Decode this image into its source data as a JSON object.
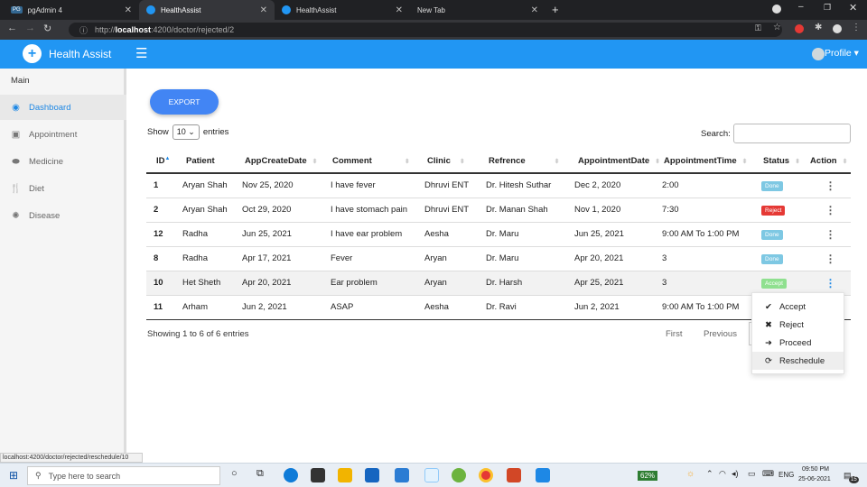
{
  "browser": {
    "tabs": [
      {
        "title": "pgAdmin 4",
        "active": false
      },
      {
        "title": "HealthAssist",
        "active": true
      },
      {
        "title": "HealthAssist",
        "active": false
      },
      {
        "title": "New Tab",
        "active": false
      }
    ],
    "url_prefix": "http://",
    "url_host": "localhost",
    "url_rest": ":4200/doctor/rejected/2",
    "status_url": "localhost:4200/doctor/rejected/reschedule/10"
  },
  "header": {
    "brand": "Health Assist",
    "profile": "Profile"
  },
  "sidebar": {
    "section": "Main",
    "items": [
      {
        "label": "Dashboard",
        "icon": "dashboard-icon",
        "active": true
      },
      {
        "label": "Appointment",
        "icon": "calendar-icon",
        "active": false
      },
      {
        "label": "Medicine",
        "icon": "pills-icon",
        "active": false
      },
      {
        "label": "Diet",
        "icon": "utensils-icon",
        "active": false
      },
      {
        "label": "Disease",
        "icon": "virus-icon",
        "active": false
      }
    ]
  },
  "main": {
    "export_label": "EXPORT",
    "show_label": "Show",
    "entries_value": "10",
    "entries_label": "entries",
    "search_label": "Search:",
    "search_value": "",
    "columns": [
      "ID",
      "Patient",
      "AppCreateDate",
      "Comment",
      "Clinic",
      "Refrence",
      "AppointmentDate",
      "AppointmentTime",
      "Status",
      "Action"
    ],
    "rows": [
      {
        "id": "1",
        "patient": "Aryan Shah",
        "created": "Nov 25, 2020",
        "comment": "I have fever",
        "clinic": "Dhruvi ENT",
        "ref": "Dr. Hitesh Suthar",
        "date": "Dec 2, 2020",
        "time": "2:00",
        "status": "Done"
      },
      {
        "id": "2",
        "patient": "Aryan Shah",
        "created": "Oct 29, 2020",
        "comment": "I have stomach pain",
        "clinic": "Dhruvi ENT",
        "ref": "Dr. Manan Shah",
        "date": "Nov 1, 2020",
        "time": "7:30",
        "status": "Reject"
      },
      {
        "id": "12",
        "patient": "Radha",
        "created": "Jun 25, 2021",
        "comment": "I have ear problem",
        "clinic": "Aesha",
        "ref": "Dr. Maru",
        "date": "Jun 25, 2021",
        "time": "9:00 AM To 1:00 PM",
        "status": "Done"
      },
      {
        "id": "8",
        "patient": "Radha",
        "created": "Apr 17, 2021",
        "comment": "Fever",
        "clinic": "Aryan",
        "ref": "Dr. Maru",
        "date": "Apr 20, 2021",
        "time": "3",
        "status": "Done"
      },
      {
        "id": "10",
        "patient": "Het Sheth",
        "created": "Apr 20, 2021",
        "comment": "Ear problem",
        "clinic": "Aryan",
        "ref": "Dr. Harsh",
        "date": "Apr 25, 2021",
        "time": "3",
        "status": "Accept"
      },
      {
        "id": "11",
        "patient": "Arham",
        "created": "Jun 2, 2021",
        "comment": "ASAP",
        "clinic": "Aesha",
        "ref": "Dr. Ravi",
        "date": "Jun 2, 2021",
        "time": "9:00 AM To 1:00 PM",
        "status": ""
      }
    ],
    "status_colors": {
      "Done": "#7ec8e3",
      "Reject": "#e53935",
      "Accept": "#8fe08f"
    },
    "info": "Showing 1 to 6 of 6 entries",
    "pager": {
      "first": "First",
      "previous": "Previous"
    },
    "menu": [
      {
        "label": "Accept",
        "icon": "check-icon"
      },
      {
        "label": "Reject",
        "icon": "x-icon"
      },
      {
        "label": "Proceed",
        "icon": "arrow-circle-icon"
      },
      {
        "label": "Reschedule",
        "icon": "refresh-icon"
      }
    ]
  },
  "taskbar": {
    "search_placeholder": "Type here to search",
    "battery": "62%",
    "lang": "ENG",
    "time": "09:50 PM",
    "date": "25-06-2021",
    "notif_count": "15"
  }
}
